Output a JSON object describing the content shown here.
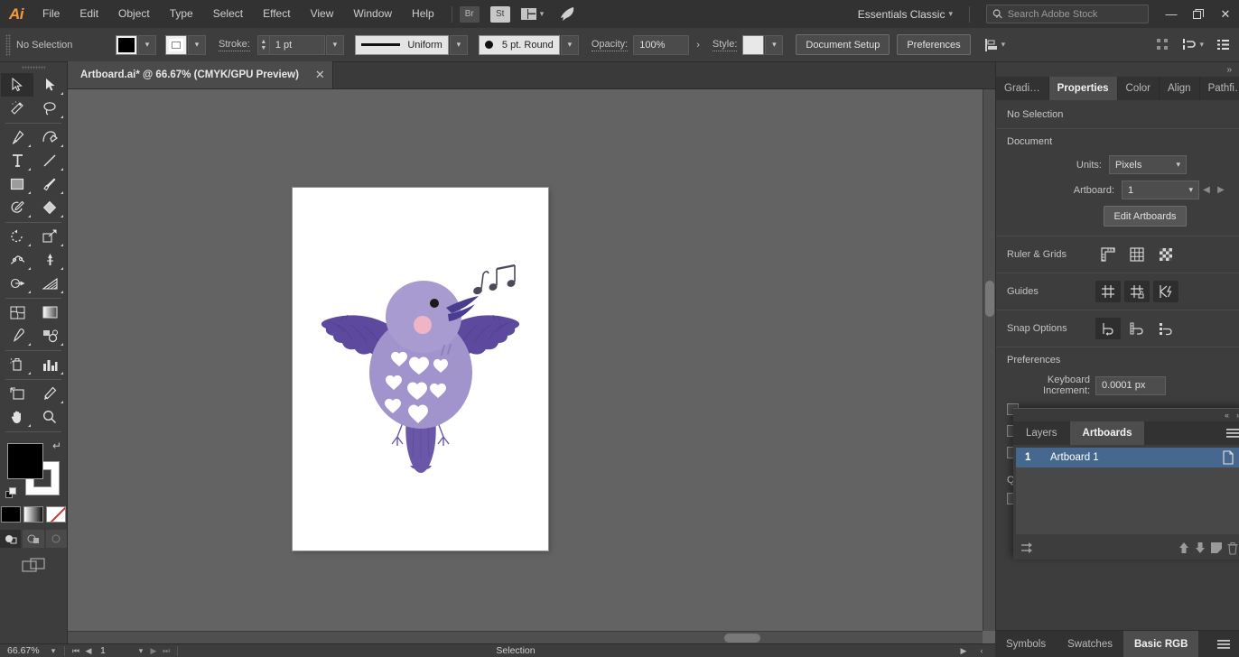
{
  "app": {
    "logo": "Ai",
    "menus": [
      "File",
      "Edit",
      "Object",
      "Type",
      "Select",
      "Effect",
      "View",
      "Window",
      "Help"
    ],
    "bridge_badge": "Br",
    "stock_badge": "St",
    "workspace": "Essentials Classic",
    "window_buttons": {
      "minimize": "—",
      "restore": "❐",
      "close": "✕"
    }
  },
  "search": {
    "placeholder": "Search Adobe Stock",
    "value": ""
  },
  "control_bar": {
    "selection_status": "No Selection",
    "fill_color": "#000000",
    "stroke_color": "#ffffff",
    "stroke_label": "Stroke:",
    "stroke_weight": "1 pt",
    "stroke_profile": "Uniform",
    "brush_definition": "5 pt. Round",
    "opacity_label": "Opacity:",
    "opacity_value": "100%",
    "style_label": "Style:",
    "document_setup_button": "Document Setup",
    "preferences_button": "Preferences"
  },
  "tools": [
    {
      "name": "selection-tool",
      "active": true
    },
    {
      "name": "direct-selection-tool",
      "active": false
    },
    {
      "name": "magic-wand-tool",
      "active": false
    },
    {
      "name": "lasso-tool",
      "active": false
    },
    {
      "name": "pen-tool",
      "active": false
    },
    {
      "name": "curvature-tool",
      "active": false
    },
    {
      "name": "type-tool",
      "active": false
    },
    {
      "name": "line-segment-tool",
      "active": false
    },
    {
      "name": "rectangle-tool",
      "active": false
    },
    {
      "name": "paintbrush-tool",
      "active": false
    },
    {
      "name": "shaper-tool",
      "active": false
    },
    {
      "name": "eraser-tool",
      "active": false
    },
    {
      "name": "rotate-tool",
      "active": false
    },
    {
      "name": "scale-tool",
      "active": false
    },
    {
      "name": "width-tool",
      "active": false
    },
    {
      "name": "free-transform-tool",
      "active": false
    },
    {
      "name": "shape-builder-tool",
      "active": false
    },
    {
      "name": "perspective-grid-tool",
      "active": false
    },
    {
      "name": "mesh-tool",
      "active": false
    },
    {
      "name": "gradient-tool",
      "active": false
    },
    {
      "name": "eyedropper-tool",
      "active": false
    },
    {
      "name": "blend-tool",
      "active": false
    },
    {
      "name": "symbol-sprayer-tool",
      "active": false
    },
    {
      "name": "column-graph-tool",
      "active": false
    },
    {
      "name": "artboard-tool",
      "active": false
    },
    {
      "name": "slice-tool",
      "active": false
    },
    {
      "name": "hand-tool",
      "active": false
    },
    {
      "name": "zoom-tool",
      "active": false
    }
  ],
  "tool_colors": {
    "fill": "#000000",
    "stroke": "#ffffff",
    "modes": [
      "color-mode",
      "gradient-mode",
      "none-mode"
    ],
    "draw_modes": [
      "draw-normal",
      "draw-behind",
      "draw-inside"
    ],
    "screen_mode": "change-screen-mode"
  },
  "document_tab": {
    "title": "Artboard.ai* @ 66.67% (CMYK/GPU Preview)",
    "close": "✕"
  },
  "canvas": {
    "artboard_background": "#ffffff",
    "canvas_background": "#636363",
    "artwork": {
      "name": "singing-bird-illustration",
      "colors": {
        "wing_dark": "#5d4a9e",
        "body_light": "#a89ccd",
        "body_mid": "#9a8cc4",
        "head": "#9e92c9",
        "tail": "#6b57a8",
        "cheek": "#f0b5c4",
        "eye": "#1a1a1a",
        "beak": "#4a3d8f",
        "hearts": "#ffffff",
        "notes": "#4a4a5a"
      }
    }
  },
  "properties_panel": {
    "tabs": [
      {
        "label": "Gradi…",
        "active": false
      },
      {
        "label": "Properties",
        "active": true
      },
      {
        "label": "Color",
        "active": false
      },
      {
        "label": "Align",
        "active": false
      },
      {
        "label": "Pathfi…",
        "active": false
      }
    ],
    "selection_status": "No Selection",
    "document_heading": "Document",
    "units_label": "Units:",
    "units_value": "Pixels",
    "artboard_label": "Artboard:",
    "artboard_value": "1",
    "edit_artboards_button": "Edit Artboards",
    "ruler_grids_label": "Ruler & Grids",
    "ruler_grids_icons": [
      "show-rulers-icon",
      "show-grid-icon",
      "show-transparency-grid-icon"
    ],
    "guides_label": "Guides",
    "guides_icons": [
      "show-guides-icon",
      "lock-guides-icon",
      "smart-guides-icon"
    ],
    "snap_options_label": "Snap Options",
    "snap_icons": [
      "snap-to-point-icon",
      "snap-to-grid-icon",
      "snap-to-pixel-icon"
    ],
    "preferences_heading": "Preferences",
    "keyboard_increment_label": "Keyboard Increment:",
    "keyboard_increment_value": "0.0001 px"
  },
  "floating_panel": {
    "tabs": [
      {
        "label": "Layers",
        "active": false
      },
      {
        "label": "Artboards",
        "active": true
      }
    ],
    "rows": [
      {
        "number": "1",
        "name": "Artboard 1",
        "selected": true
      }
    ],
    "footer_icons": [
      "rearrange-artboards-icon",
      "move-up-icon",
      "move-down-icon",
      "new-artboard-icon",
      "delete-artboard-icon"
    ]
  },
  "bottom_tabs": [
    {
      "label": "Symbols",
      "active": false
    },
    {
      "label": "Swatches",
      "active": false
    },
    {
      "label": "Basic RGB",
      "active": true
    }
  ],
  "status_bar": {
    "zoom_level": "66.67%",
    "page_number": "1",
    "status_text": "Selection"
  }
}
